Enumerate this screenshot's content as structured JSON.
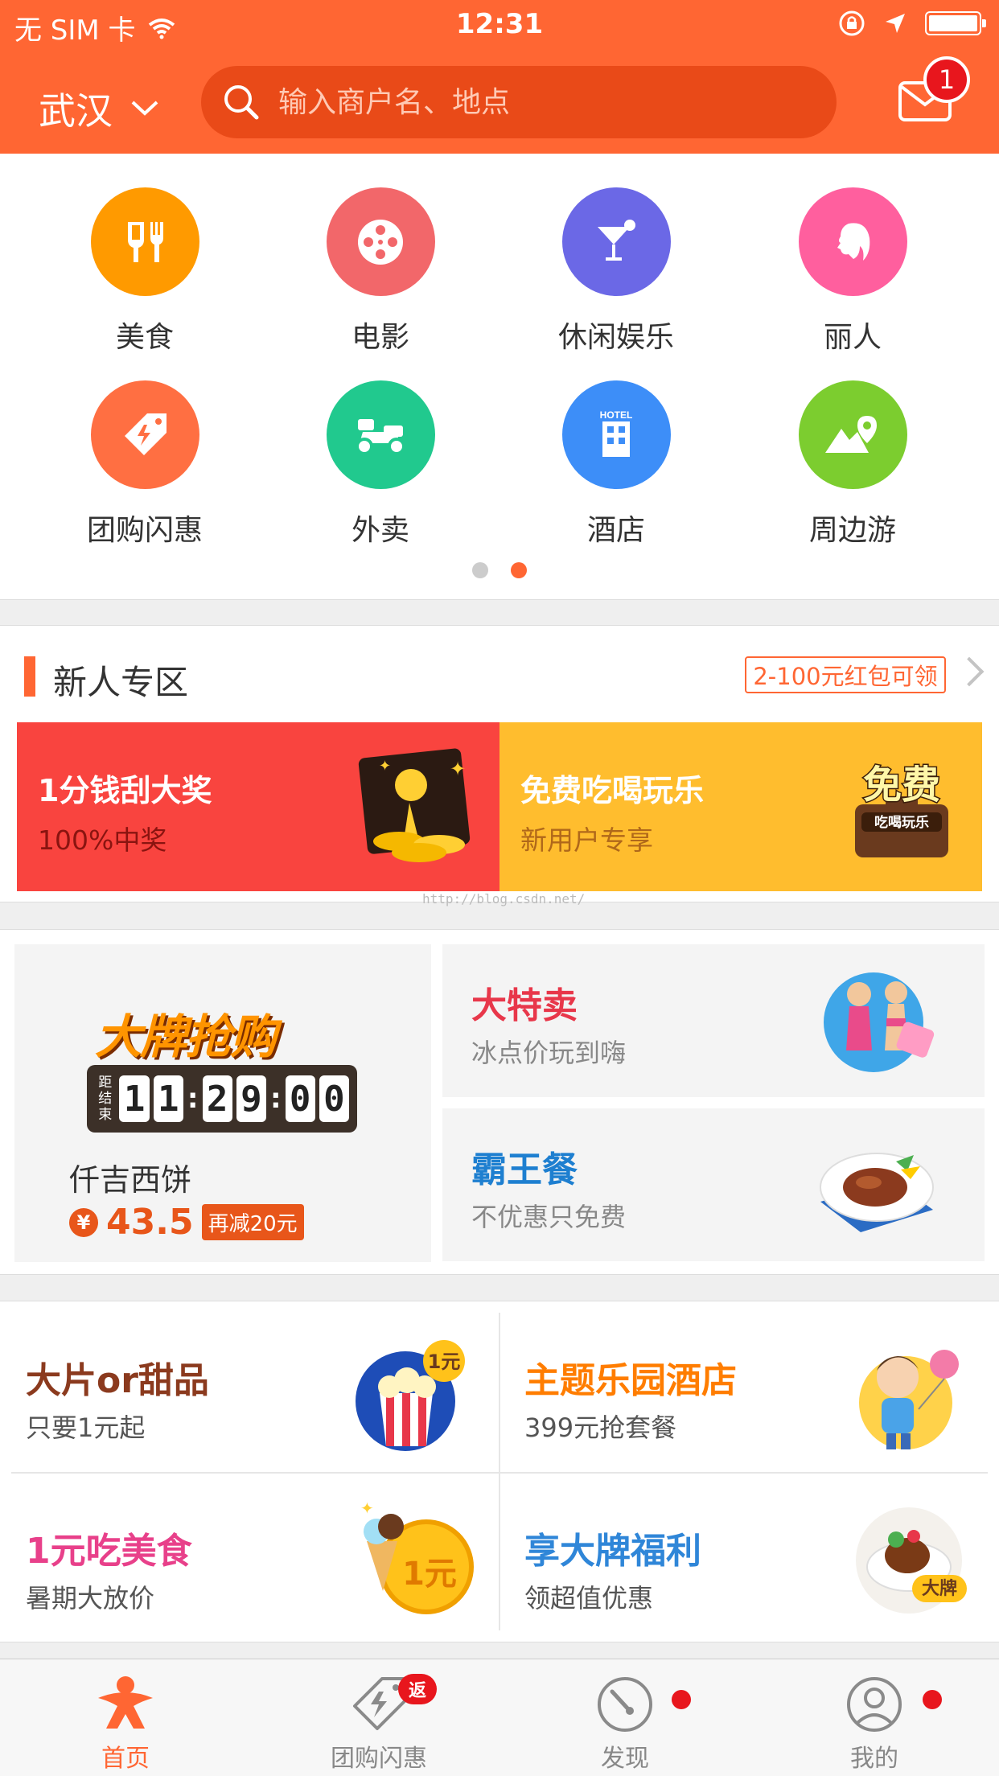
{
  "status_bar": {
    "carrier": "无 SIM 卡",
    "time": "12:31"
  },
  "header": {
    "city": "武汉",
    "search_placeholder": "输入商户名、地点",
    "message_count": "1",
    "brand_color": "#ff6633"
  },
  "categories": [
    {
      "label": "美食",
      "icon": "fork-knife-icon",
      "color": "#ff9a00"
    },
    {
      "label": "电影",
      "icon": "film-reel-icon",
      "color": "#f2676a"
    },
    {
      "label": "休闲娱乐",
      "icon": "cocktail-icon",
      "color": "#6b68e6"
    },
    {
      "label": "丽人",
      "icon": "woman-profile-icon",
      "color": "#ff5f9e"
    },
    {
      "label": "团购闪惠",
      "icon": "flash-tag-icon",
      "color": "#ff6f42"
    },
    {
      "label": "外卖",
      "icon": "scooter-icon",
      "color": "#21c98e"
    },
    {
      "label": "酒店",
      "icon": "hotel-icon",
      "color": "#3d8ef8",
      "icon_text": "HOTEL"
    },
    {
      "label": "周边游",
      "icon": "mountain-pin-icon",
      "color": "#7ccd2f"
    }
  ],
  "page_indicator": {
    "count": 2,
    "active": 1
  },
  "newbie": {
    "title": "新人专区",
    "tag": "2-100元红包可领",
    "cards": [
      {
        "title": "1分钱刮大奖",
        "sub": "100%中奖",
        "bg": "#f9443f"
      },
      {
        "title": "免费吃喝玩乐",
        "sub": "新用户专享",
        "bg": "#ffbd2e",
        "badge_text": "免费",
        "badge_sub": "吃喝玩乐"
      }
    ],
    "watermark": "http://blog.csdn.net/"
  },
  "brand_sale": {
    "logo": "大牌抢购",
    "countdown_label": [
      "距",
      "结",
      "束"
    ],
    "countdown_digits": [
      "1",
      "1",
      "2",
      "9",
      "0",
      "0"
    ],
    "deal_name": "仟吉西饼",
    "currency": "¥",
    "price": "43.5",
    "discount": "再减20元"
  },
  "promo_cards": [
    {
      "title": "大特卖",
      "sub": "冰点价玩到嗨",
      "color": "#e8374a"
    },
    {
      "title": "霸王餐",
      "sub": "不优惠只免费",
      "color": "#1e7fd0"
    }
  ],
  "grid": [
    {
      "title": "大片or甜品",
      "sub": "只要1元起",
      "color": "#8b3a1e",
      "badge": "1元"
    },
    {
      "title": "主题乐园酒店",
      "sub": "399元抢套餐",
      "color": "#ff7d00"
    },
    {
      "title": "1元吃美食",
      "sub": "暑期大放价",
      "color": "#e8408a",
      "badge": "1元"
    },
    {
      "title": "享大牌福利",
      "sub": "领超值优惠",
      "color": "#2f86d8",
      "badge": "大牌"
    }
  ],
  "tabbar": [
    {
      "label": "首页",
      "icon": "home-person-icon",
      "active": true
    },
    {
      "label": "团购闪惠",
      "icon": "flash-tag-icon",
      "badge": "返"
    },
    {
      "label": "发现",
      "icon": "compass-icon",
      "dot": true
    },
    {
      "label": "我的",
      "icon": "user-icon",
      "dot": true
    }
  ]
}
